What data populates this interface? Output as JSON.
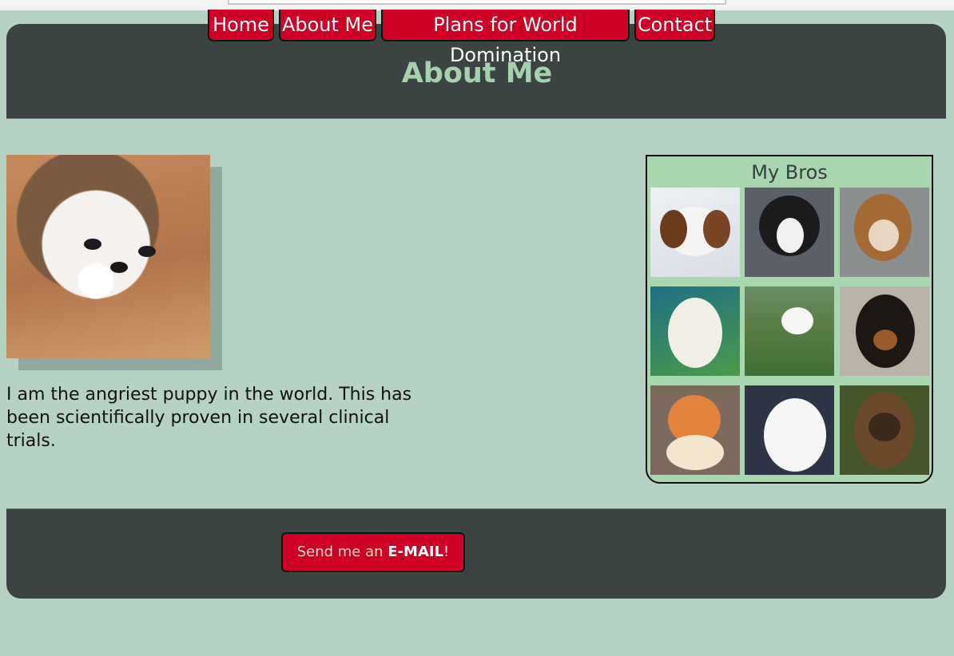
{
  "nav": {
    "items": [
      {
        "label": "Home"
      },
      {
        "label": "About Me"
      },
      {
        "label": "Plans for World Domination"
      },
      {
        "label": "Contact"
      }
    ]
  },
  "header": {
    "title": "About Me"
  },
  "main": {
    "intro_text": "I am the angriest puppy in the world. This has been scientifically proven in several clinical trials."
  },
  "sidebar": {
    "title": "My Bros",
    "thumbnails": [
      {
        "icon": "beagle-puppy-image"
      },
      {
        "icon": "black-white-puppy-image"
      },
      {
        "icon": "beagle-waving-image"
      },
      {
        "icon": "white-lab-puppy-image"
      },
      {
        "icon": "white-puppy-grass-image"
      },
      {
        "icon": "doberman-puppy-image"
      },
      {
        "icon": "pomeranian-image"
      },
      {
        "icon": "white-fluffy-puppy-image"
      },
      {
        "icon": "ewok-image"
      }
    ]
  },
  "footer": {
    "email_prefix": "Send me an ",
    "email_strong": "E-MAIL",
    "email_suffix": "!"
  },
  "colors": {
    "background": "#b5d2c4",
    "panel": "#3c4443",
    "accent_red": "#cf0026",
    "title_green": "#a6d1af",
    "sidebar_green": "#a8d6ae"
  }
}
